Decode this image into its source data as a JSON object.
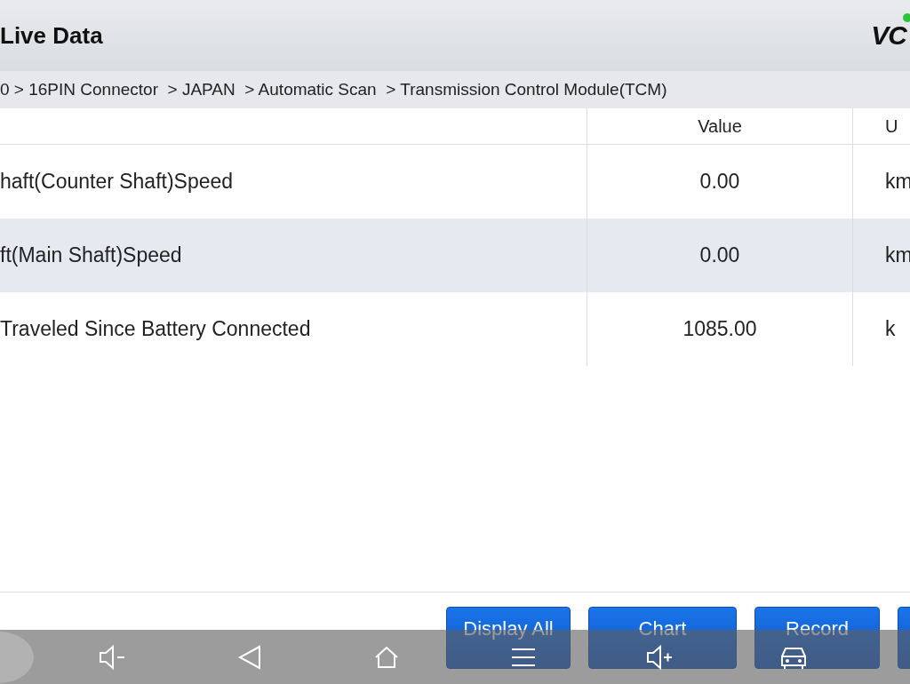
{
  "header": {
    "title": "Live Data",
    "logo": "VC"
  },
  "breadcrumb": "0 > 16PIN Connector  > JAPAN  > Automatic Scan  > Transmission Control Module(TCM)",
  "table": {
    "columns": [
      "",
      "Value",
      "U"
    ],
    "rows": [
      {
        "name": "haft(Counter Shaft)Speed",
        "value": "0.00",
        "unit": "km",
        "selected": false
      },
      {
        "name": "ft(Main Shaft)Speed",
        "value": "0.00",
        "unit": "km",
        "selected": true
      },
      {
        "name": "Traveled Since Battery Connected",
        "value": "1085.00",
        "unit": "k",
        "selected": false
      }
    ]
  },
  "buttons": [
    {
      "label": "Display All"
    },
    {
      "label": "Chart"
    },
    {
      "label": "Record"
    }
  ]
}
